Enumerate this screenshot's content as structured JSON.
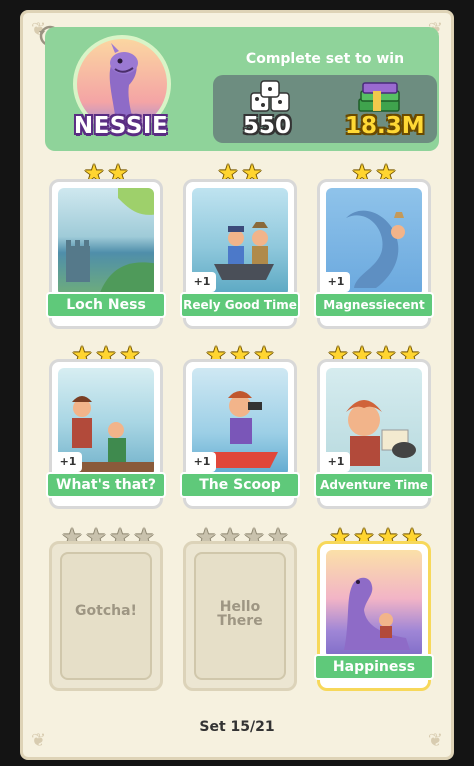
{
  "header": {
    "character_name": "NESSIE",
    "subtitle": "Complete set to win",
    "rewards": {
      "dice": "550",
      "cash": "18.3M"
    }
  },
  "cards": [
    {
      "name": "Loch Ness",
      "stars": 2,
      "extra": "",
      "collected": true
    },
    {
      "name": "Reely Good Time",
      "stars": 2,
      "extra": "+1",
      "collected": true
    },
    {
      "name": "Magnessiecent",
      "stars": 2,
      "extra": "+1",
      "collected": true
    },
    {
      "name": "What's that?",
      "stars": 3,
      "extra": "+1",
      "collected": true
    },
    {
      "name": "The Scoop",
      "stars": 3,
      "extra": "+1",
      "collected": true
    },
    {
      "name": "Adventure Time",
      "stars": 4,
      "extra": "+1",
      "collected": true
    },
    {
      "name": "Gotcha!",
      "stars": 4,
      "extra": "",
      "collected": false
    },
    {
      "name": "Hello\nThere",
      "stars": 4,
      "extra": "",
      "collected": false
    },
    {
      "name": "Happiness",
      "stars": 4,
      "extra": "",
      "collected": true
    }
  ],
  "footer": {
    "set_label": "Set 15/21"
  },
  "colors": {
    "label_green": "#5fc97a",
    "header_green": "#8fd39a",
    "star_gold": "#ffd530"
  },
  "icons": {
    "history": "history-icon",
    "dice": "dice-icon",
    "cash": "cash-stack-icon"
  }
}
